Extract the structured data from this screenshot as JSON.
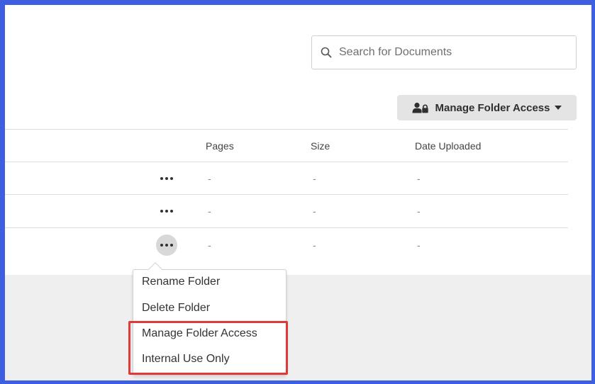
{
  "search": {
    "placeholder": "Search for Documents"
  },
  "toolbar": {
    "manage_access_label": "Manage Folder Access"
  },
  "table": {
    "columns": [
      "Pages",
      "Size",
      "Date Uploaded"
    ],
    "rows": [
      {
        "pages": "-",
        "size": "-",
        "date": "-"
      },
      {
        "pages": "-",
        "size": "-",
        "date": "-"
      },
      {
        "pages": "-",
        "size": "-",
        "date": "-"
      }
    ]
  },
  "context_menu": {
    "items": [
      "Rename Folder",
      "Delete Folder",
      "Manage Folder Access",
      "Internal Use Only"
    ]
  },
  "colors": {
    "frame_border": "#3e5fe0",
    "highlight": "#e0393a",
    "button_bg": "#e4e4e4"
  },
  "icons": [
    "search-icon",
    "users-lock-icon",
    "caret-down-icon",
    "more-icon"
  ]
}
